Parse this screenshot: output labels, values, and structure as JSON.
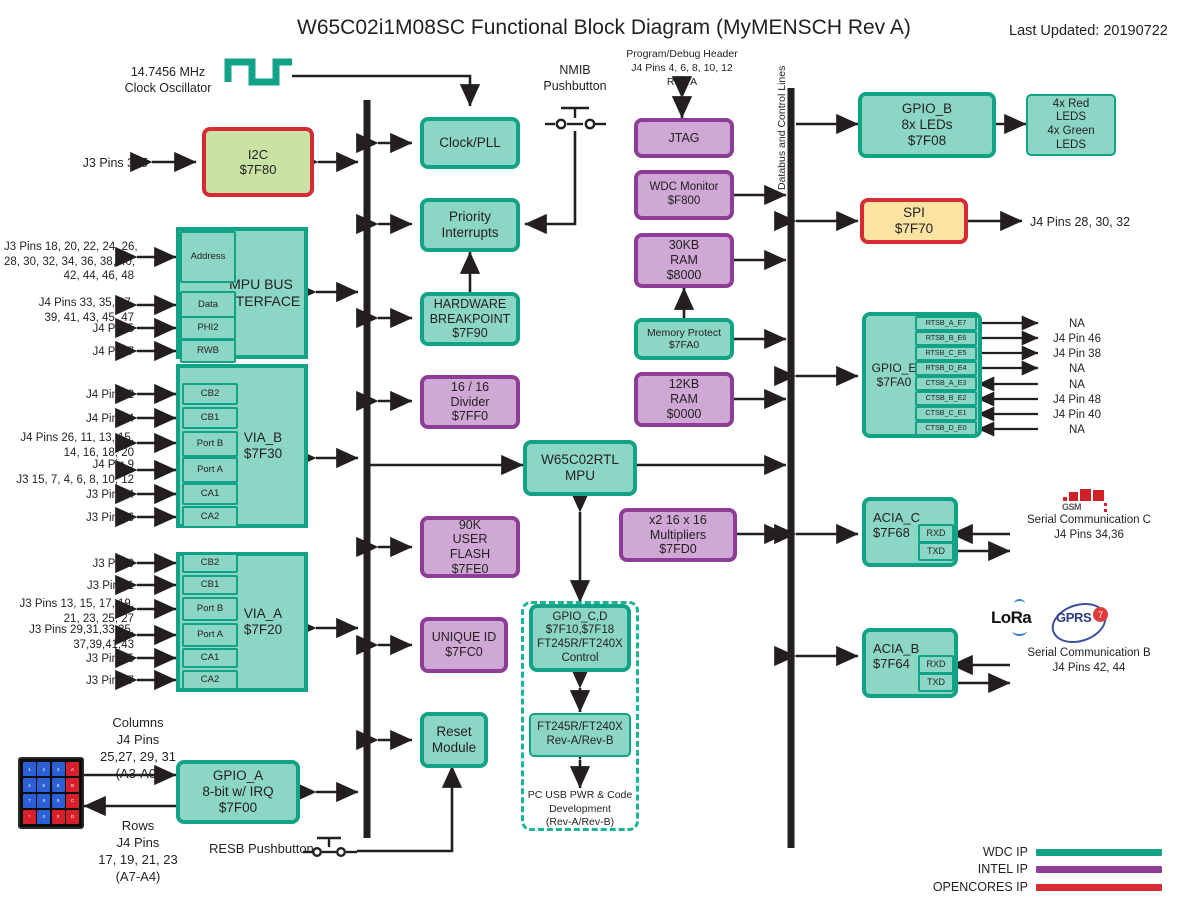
{
  "title": "W65C02i1M08SC Functional Block Diagram (MyMENSCH Rev A)",
  "last_updated": "Last Updated: 20190722",
  "bus": {
    "label": "Databus and Control Lines"
  },
  "clock": {
    "line1": "14.7456 MHz",
    "line2": "Clock Oscillator",
    "icon": "square-wave-icon"
  },
  "nmib": {
    "line1": "NMIB",
    "line2": "Pushbutton",
    "icon": "pushbutton-icon"
  },
  "resb": {
    "label": "RESB Pushbutton",
    "icon": "pushbutton-icon"
  },
  "debug_header": {
    "line1": "Program/Debug Header",
    "line2": "J4 Pins 4, 6, 8, 10, 12",
    "line3": "Rev. A"
  },
  "center_blocks": [
    {
      "name": "clock-pll",
      "lines": [
        "Clock/PLL"
      ],
      "ip": "wdc"
    },
    {
      "name": "priority-interrupts",
      "lines": [
        "Priority",
        "Interrupts"
      ],
      "ip": "wdc"
    },
    {
      "name": "hardware-breakpoint",
      "lines": [
        "HARDWARE",
        "BREAKPOINT",
        "$7F90"
      ],
      "ip": "wdc"
    },
    {
      "name": "divider",
      "lines": [
        "16 / 16",
        "Divider",
        "$7FF0"
      ],
      "ip": "intel"
    },
    {
      "name": "user-flash",
      "lines": [
        "90K",
        "USER",
        "FLASH",
        "$7FE0"
      ],
      "ip": "intel"
    },
    {
      "name": "unique-id",
      "lines": [
        "UNIQUE ID",
        "$7FC0"
      ],
      "ip": "intel"
    },
    {
      "name": "reset-module",
      "lines": [
        "Reset",
        "Module"
      ],
      "ip": "wdc"
    }
  ],
  "i2c": {
    "lines": [
      "I2C",
      "$7F80"
    ],
    "ip": "opencores",
    "pins": "J3 Pins 3, 5"
  },
  "spi": {
    "lines": [
      "SPI",
      "$7F70"
    ],
    "ip": "opencores",
    "pins": "J4 Pins 28, 30, 32"
  },
  "mpu_bus": {
    "title_lines": [
      "MPU BUS",
      "INTERFACE"
    ],
    "ports": [
      {
        "label": "Address",
        "pins": "J3 Pins 18, 20, 22, 24, 26,\n28, 30, 32, 34, 36, 38, 40,\n42, 44, 46, 48"
      },
      {
        "label": "Data",
        "pins": "J4 Pins 33, 35, 37,\n39, 41, 43, 45, 47"
      },
      {
        "label": "PHI2",
        "pins": "J4 Pin 5"
      },
      {
        "label": "RWB",
        "pins": "J4 Pin 7"
      }
    ]
  },
  "via_b": {
    "title_lines": [
      "VIA_B",
      "$7F30"
    ],
    "ports": [
      {
        "label": "CB2",
        "pins": "J4 Pin 22"
      },
      {
        "label": "CB1",
        "pins": "J4 Pin 24"
      },
      {
        "label": "Port B",
        "pins": "J4 Pins 26, 11, 13, 15,\n14, 16, 18, 20"
      },
      {
        "label": "Port A",
        "pins": "J4 Pin 9\nJ3 15, 7, 4, 6, 8, 10, 12"
      },
      {
        "label": "CA1",
        "pins": "J3 Pin 14"
      },
      {
        "label": "CA2",
        "pins": "J3 Pin 16"
      }
    ]
  },
  "via_a": {
    "title_lines": [
      "VIA_A",
      "$7F20"
    ],
    "ports": [
      {
        "label": "CB2",
        "pins": "J3 Pin 9"
      },
      {
        "label": "CB1",
        "pins": "J3 Pin 11"
      },
      {
        "label": "Port B",
        "pins": "J3 Pins 13, 15, 17, 19,\n21, 23, 25, 27"
      },
      {
        "label": "Port A",
        "pins": "J3 Pins 29,31,33,35,\n37,39,41,43"
      },
      {
        "label": "CA1",
        "pins": "J3 Pin 45"
      },
      {
        "label": "CA2",
        "pins": "J3 Pin 47"
      }
    ]
  },
  "gpio_a": {
    "lines": [
      "GPIO_A",
      "8-bit w/ IRQ",
      "$7F00"
    ],
    "ip": "wdc",
    "columns": "Columns\nJ4 Pins\n25,27, 29, 31\n(A3-A0)",
    "rows": "Rows\nJ4 Pins\n17, 19, 21, 23\n(A7-A4)",
    "keypad": {
      "name": "keypad-icon",
      "keys": [
        "1",
        "2",
        "3",
        "A",
        "4",
        "5",
        "6",
        "B",
        "7",
        "8",
        "9",
        "C",
        "*",
        "0",
        "#",
        "D"
      ],
      "colors": [
        "b",
        "b",
        "b",
        "r",
        "b",
        "b",
        "b",
        "r",
        "b",
        "b",
        "b",
        "r",
        "r",
        "b",
        "r",
        "r"
      ]
    }
  },
  "right_column_left": [
    {
      "name": "jtag",
      "lines": [
        "JTAG"
      ],
      "ip": "intel"
    },
    {
      "name": "wdc-monitor",
      "lines": [
        "WDC Monitor",
        "$F800"
      ],
      "ip": "intel"
    },
    {
      "name": "ram-30kb",
      "lines": [
        "30KB",
        "RAM",
        "$8000"
      ],
      "ip": "intel"
    },
    {
      "name": "memory-protect",
      "lines": [
        "Memory Protect",
        "$7FA0"
      ],
      "ip": "wdc"
    },
    {
      "name": "ram-12kb",
      "lines": [
        "12KB",
        "RAM",
        "$0000"
      ],
      "ip": "intel"
    },
    {
      "name": "multipliers",
      "lines": [
        "x2 16 x 16",
        "Multipliers",
        "$7FD0"
      ],
      "ip": "intel"
    }
  ],
  "mpu_core": {
    "lines": [
      "W65C02RTL",
      "MPU"
    ],
    "ip": "wdc"
  },
  "gpio_cd": {
    "lines": [
      "GPIO_C,D",
      "$7F10,$7F18",
      "FT245R/FT240X",
      "Control"
    ],
    "ip": "wdc"
  },
  "ft245r": {
    "lines": [
      "FT245R/FT240X",
      "Rev-A/Rev-B"
    ]
  },
  "usb_note": "PC USB PWR & Code\nDevelopment\n(Rev-A/Rev-B)",
  "gpio_b": {
    "lines": [
      "GPIO_B",
      "8x LEDs",
      "$7F08"
    ],
    "ip": "wdc"
  },
  "leds": {
    "lines": [
      "4x Red",
      "LEDS",
      "4x Green",
      "LEDS"
    ],
    "ip": "thin"
  },
  "gpio_e": {
    "title_lines": [
      "GPIO_E",
      "$7FA0"
    ],
    "signals": [
      {
        "label": "RTSB_A_E7",
        "dir": "out",
        "pin": "NA"
      },
      {
        "label": "RTSB_B_E6",
        "dir": "out",
        "pin": "J4 Pin 46"
      },
      {
        "label": "RTSB_C_E5",
        "dir": "out",
        "pin": "J4 Pin 38"
      },
      {
        "label": "RTSB_D_E4",
        "dir": "out",
        "pin": "NA"
      },
      {
        "label": "CTSB_A_E3",
        "dir": "in",
        "pin": "NA"
      },
      {
        "label": "CTSB_B_E2",
        "dir": "in",
        "pin": "J4 Pin 48"
      },
      {
        "label": "CTSB_C_E1",
        "dir": "in",
        "pin": "J4 Pin 40"
      },
      {
        "label": "CTSB_D_E0",
        "dir": "in",
        "pin": "NA"
      }
    ]
  },
  "acia_c": {
    "lines": [
      "ACIA_C",
      "$7F68"
    ],
    "rxd": "RXD",
    "txd": "TXD",
    "caption": "Serial Communication C\nJ4 Pins 34,36",
    "logo": "gsm-logo"
  },
  "acia_b": {
    "lines": [
      "ACIA_B",
      "$7F64"
    ],
    "rxd": "RXD",
    "txd": "TXD",
    "caption": "Serial Communication B\nJ4 Pins 42, 44",
    "logos": [
      "lora-logo",
      "gprs-logo"
    ]
  },
  "legend": [
    {
      "label": "WDC IP",
      "color": "#12A386"
    },
    {
      "label": "INTEL IP",
      "color": "#8E3D96"
    },
    {
      "label": "OPENCORES IP",
      "color": "#D62B35"
    }
  ],
  "colors": {
    "wdc_border": "#12A386",
    "wdc_fill": "#8CD6C6",
    "intel_border": "#8E3D96",
    "intel_fill": "#CFA8D5",
    "oc_border": "#D62B35",
    "oc_fill_green": "#C9E3A4",
    "oc_fill_amber": "#FBE3A2",
    "wire": "#231f20"
  }
}
